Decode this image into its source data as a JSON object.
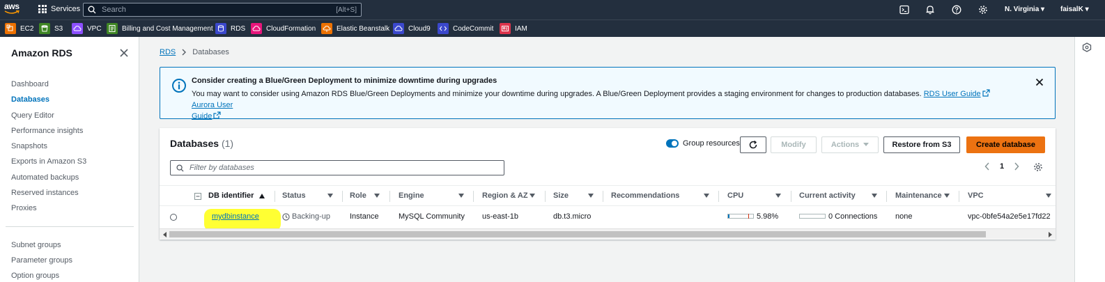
{
  "topnav": {
    "logo_text": "aws",
    "services_label": "Services",
    "search_placeholder": "Search",
    "search_shortcut": "[Alt+S]",
    "icons": [
      "cloudshell-icon",
      "bell-icon",
      "help-icon",
      "gear-icon"
    ],
    "region": "N. Virginia ▾",
    "user": "faisalK ▾"
  },
  "favorites": [
    {
      "label": "EC2",
      "color": "#ed7100"
    },
    {
      "label": "S3",
      "color": "#3f8624"
    },
    {
      "label": "VPC",
      "color": "#8c4fff"
    },
    {
      "label": "Billing and Cost Management",
      "color": "#3f8624"
    },
    {
      "label": "RDS",
      "color": "#3b48cc"
    },
    {
      "label": "CloudFormation",
      "color": "#e7157b"
    },
    {
      "label": "Elastic Beanstalk",
      "color": "#ed7100"
    },
    {
      "label": "Cloud9",
      "color": "#3b48cc"
    },
    {
      "label": "CodeCommit",
      "color": "#3b48cc"
    },
    {
      "label": "IAM",
      "color": "#dd344c"
    }
  ],
  "sidebar": {
    "title": "Amazon RDS",
    "items": [
      {
        "label": "Dashboard",
        "active": false
      },
      {
        "label": "Databases",
        "active": true
      },
      {
        "label": "Query Editor",
        "active": false
      },
      {
        "label": "Performance insights",
        "active": false
      },
      {
        "label": "Snapshots",
        "active": false
      },
      {
        "label": "Exports in Amazon S3",
        "active": false
      },
      {
        "label": "Automated backups",
        "active": false
      },
      {
        "label": "Reserved instances",
        "active": false
      },
      {
        "label": "Proxies",
        "active": false
      }
    ],
    "items2": [
      {
        "label": "Subnet groups"
      },
      {
        "label": "Parameter groups"
      },
      {
        "label": "Option groups"
      }
    ]
  },
  "breadcrumb": {
    "root": "RDS",
    "current": "Databases"
  },
  "flash": {
    "title": "Consider creating a Blue/Green Deployment to minimize downtime during upgrades",
    "body": "You may want to consider using Amazon RDS Blue/Green Deployments and minimize your downtime during upgrades. A Blue/Green Deployment provides a staging environment for changes to production databases.",
    "link1": "RDS User Guide",
    "link2a": "Aurora User",
    "link2b": "Guide"
  },
  "panel": {
    "title": "Databases",
    "count": "(1)",
    "group_resources": "Group resources",
    "buttons": {
      "modify": "Modify",
      "actions": "Actions",
      "restore": "Restore from S3",
      "create": "Create database"
    },
    "filter_placeholder": "Filter by databases",
    "page": "1"
  },
  "table": {
    "columns": [
      "DB identifier",
      "Status",
      "Role",
      "Engine",
      "Region & AZ",
      "Size",
      "Recommendations",
      "CPU",
      "Current activity",
      "Maintenance",
      "VPC"
    ],
    "rows": [
      {
        "identifier": "mydbinstance",
        "status": "Backing-up",
        "role": "Instance",
        "engine": "MySQL Community",
        "region": "us-east-1b",
        "size": "db.t3.micro",
        "recommendations": "",
        "cpu": "5.98%",
        "cpu_fraction": 0.0598,
        "activity": "0 Connections",
        "maintenance": "none",
        "vpc": "vpc-0bfe54a2e5e17fd22"
      }
    ]
  }
}
